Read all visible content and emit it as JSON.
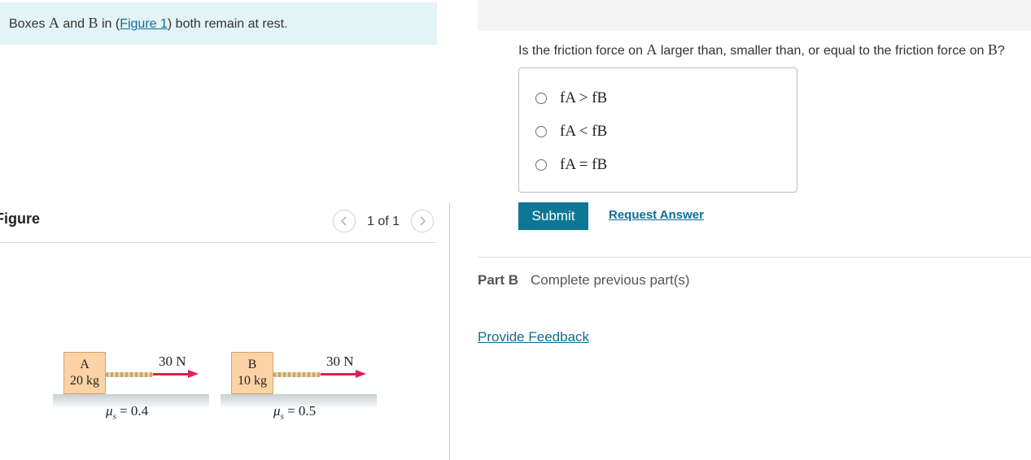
{
  "intro": {
    "prefix": "Boxes ",
    "box_a": "A",
    "and": " and ",
    "box_b": "B",
    "in_open": " in (",
    "figure_link": "Figure 1",
    "suffix": ") both remain at rest."
  },
  "figure_panel": {
    "title": "Figure",
    "page_indicator": "1 of 1"
  },
  "figure": {
    "box_a": {
      "letter": "A",
      "mass": "20 kg",
      "force": "30 N",
      "mu_symbol": "μ",
      "mu_sub": "s",
      "mu_value": " = 0.4"
    },
    "box_b": {
      "letter": "B",
      "mass": "10 kg",
      "force": "30 N",
      "mu_symbol": "μ",
      "mu_sub": "s",
      "mu_value": " = 0.5"
    }
  },
  "question": {
    "text_1": "Is the friction force on ",
    "var_a": "A",
    "text_2": " larger than, smaller than, or equal to the friction force on ",
    "var_b": "B",
    "text_3": "?"
  },
  "options": [
    {
      "label": "fA > fB"
    },
    {
      "label": "fA < fB"
    },
    {
      "label": "fA = fB"
    }
  ],
  "actions": {
    "submit": "Submit",
    "request_answer": "Request Answer"
  },
  "part_b": {
    "label": "Part B",
    "status": "Complete previous part(s)"
  },
  "feedback": "Provide Feedback",
  "colors": {
    "accent": "#0e7795",
    "link": "#0b6e9b",
    "banner": "#e4f3f5",
    "force_arrow": "#e0204f",
    "box_fill": "#fcd3a6"
  }
}
